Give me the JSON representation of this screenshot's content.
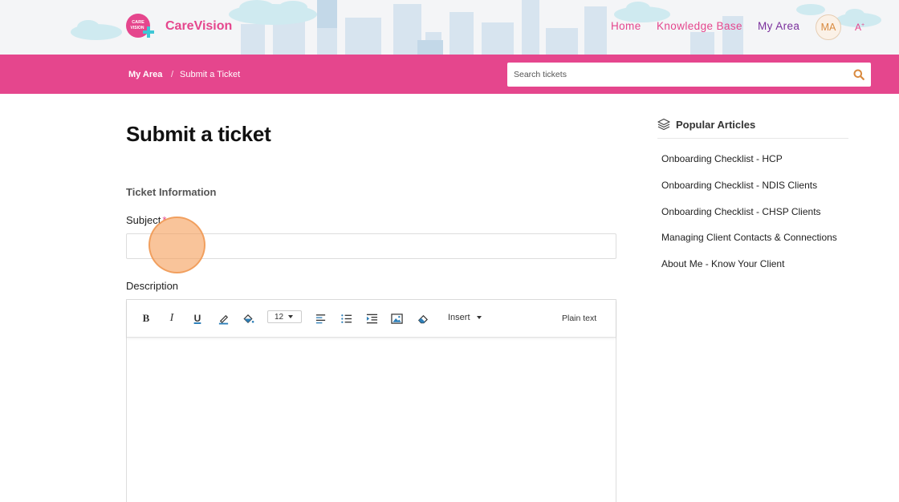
{
  "header": {
    "logo_mark_text": "CARE VISION",
    "brand": "CareVision",
    "nav": {
      "home": "Home",
      "knowledge_base": "Knowledge Base",
      "my_area": "My Area"
    },
    "avatar_initials": "MA",
    "font_toggle": "A"
  },
  "breadcrumb": {
    "parent": "My Area",
    "separator": "/",
    "current": "Submit a Ticket"
  },
  "search": {
    "placeholder": "Search tickets",
    "icon": "search-icon"
  },
  "form": {
    "title": "Submit a ticket",
    "section": "Ticket Information",
    "subject_label": "Subject",
    "subject_required": "*",
    "subject_value": "",
    "description_label": "Description",
    "toolbar": {
      "bold": "B",
      "italic": "I",
      "underline": "U",
      "font_size": "12",
      "insert": "Insert",
      "plain_text": "Plain text",
      "icons": [
        "pen-color-icon",
        "fill-color-icon",
        "align-left-icon",
        "bullet-list-icon",
        "indent-icon",
        "image-icon",
        "eraser-icon"
      ]
    }
  },
  "sidebar": {
    "title": "Popular Articles",
    "icon": "layers-icon",
    "articles": [
      "Onboarding Checklist - HCP",
      "Onboarding Checklist - NDIS Clients",
      "Onboarding Checklist - CHSP Clients",
      "Managing Client Contacts & Connections",
      "About Me - Know Your Client"
    ]
  },
  "colors": {
    "brand_pink": "#e5468d",
    "nav_active_purple": "#7a2f9c",
    "accent_orange": "#d98a3f",
    "toolbar_blue": "#2d7fb8"
  }
}
